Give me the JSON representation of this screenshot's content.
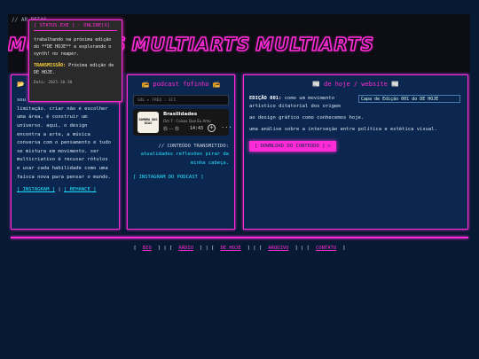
{
  "header": {
    "ticker": "// AR                                            DEIAS.",
    "logo_words": [
      "MULTIARTS",
      "MULTIARTS",
      "MULTIARTS"
    ]
  },
  "status_popup": {
    "title": "[ STATUS.EXE ] - ONLINE[X]",
    "message": "trabalhando na próxima edição do **DE HOJE** e explorando o synth! no reaper.",
    "transmission_label": "TRANSMISSÃO:",
    "transmission_text": "Próxima edição de DE HOJE.",
    "date": "Data: 2025-10-30"
  },
  "about": {
    "title_icon": "📂",
    "body": "sou ... é um manifesto contra a limitação. criar não é escolher uma área, é construir um universo. aqui, o design encontra a arte, a música conversa com o pensamento e tudo se mistura em movimento. ser multicriativo é recusar rótulos e usar cada habilidade como uma faísca nova para pensar o mundo.",
    "links": [
      "[ INSTAGRAM ]",
      "|",
      "[ BEHANCE ]"
    ]
  },
  "podcast": {
    "title": "📻 podcast fofinho 📻",
    "search_placeholder": "SOL  ▸  FREQ  :  ECI",
    "player": {
      "cover_text": "SOMBRA DOS DIAS",
      "show": "Brasilidades",
      "subtitle": "Oct 7 · Coisas Que Eu Amo",
      "controls": "⑮ ··· ⑮",
      "time": "14:43",
      "plus": "+",
      "more": "···"
    },
    "transmit_label": "// CONTEÚDO TRANSMITIDO:",
    "transmit_value": "atualidades reflexões pirar da minha cabeça.",
    "ig_link": "[ INSTAGRAM DO PODCAST ]"
  },
  "today": {
    "title": "📰 de hoje / website 📰",
    "edition_label": "EDIÇÃO 001:",
    "edition_text": "como um movimento artístico ditatorial dos origem",
    "edition_line2": "ao design gráfico como conhecemos hoje.",
    "image_alt": "Capa de Edição 001 do DE HOJE",
    "analysis": "uma análise sobre a interseção entre política e estética visual.",
    "download_button": "[ DOWNLOAD DO CONTEÚDO ] ▷"
  },
  "footer": {
    "items": [
      "BIO",
      "RÁDIO",
      "DE HOJE",
      "ARQUIVO",
      "CONTATO"
    ]
  },
  "colors": {
    "accent": "#ff2bd6",
    "link": "#22e3ff",
    "panel": "#0b2750",
    "background": "#071a33"
  }
}
